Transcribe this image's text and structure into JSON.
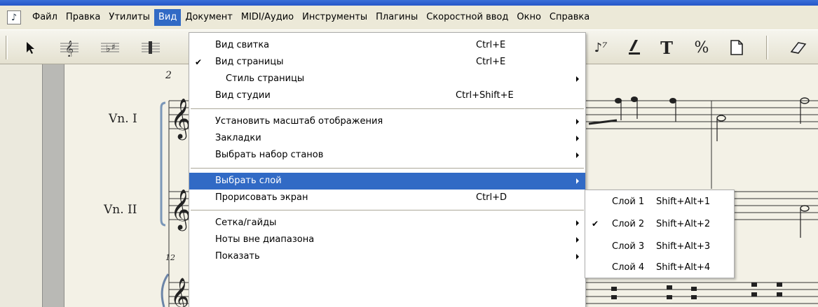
{
  "menubar": {
    "items": [
      {
        "label": "Файл"
      },
      {
        "label": "Правка"
      },
      {
        "label": "Утилиты"
      },
      {
        "label": "Вид",
        "active": true
      },
      {
        "label": "Документ"
      },
      {
        "label": "MIDI/Аудио"
      },
      {
        "label": "Инструменты"
      },
      {
        "label": "Плагины"
      },
      {
        "label": "Скоростной ввод"
      },
      {
        "label": "Окно"
      },
      {
        "label": "Справка"
      }
    ]
  },
  "toolbar": {
    "tools_right": [
      {
        "icon": "text-tool-icon",
        "glyph": "T"
      },
      {
        "icon": "percent-tool-icon",
        "glyph": "%"
      }
    ]
  },
  "score": {
    "instruments": [
      {
        "label": "Vn. I"
      },
      {
        "label": "Vn. II"
      }
    ],
    "measure_numbers": [
      "2",
      "12"
    ]
  },
  "view_menu": {
    "items": [
      {
        "label": "Вид свитка",
        "shortcut": "Ctrl+E"
      },
      {
        "label": "Вид страницы",
        "shortcut": "Ctrl+E",
        "checked": true
      },
      {
        "label": "Стиль страницы",
        "submenu": true
      },
      {
        "label": "Вид студии",
        "shortcut": "Ctrl+Shift+E"
      },
      {
        "label": "Установить масштаб отображения",
        "submenu": true
      },
      {
        "label": "Закладки",
        "submenu": true
      },
      {
        "label": "Выбрать набор станов",
        "submenu": true
      },
      {
        "label": "Выбрать слой",
        "submenu": true,
        "highlighted": true
      },
      {
        "label": "Прорисовать экран",
        "shortcut": "Ctrl+D"
      },
      {
        "label": "Сетка/гайды",
        "submenu": true
      },
      {
        "label": "Ноты вне диапазона",
        "submenu": true
      },
      {
        "label": "Показать",
        "submenu": true
      }
    ]
  },
  "layer_submenu": {
    "items": [
      {
        "label": "Слой 1",
        "shortcut": "Shift+Alt+1"
      },
      {
        "label": "Слой 2",
        "shortcut": "Shift+Alt+2",
        "checked": true
      },
      {
        "label": "Слой 3",
        "shortcut": "Shift+Alt+3"
      },
      {
        "label": "Слой 4",
        "shortcut": "Shift+Alt+4"
      }
    ]
  },
  "colors": {
    "highlight": "#316ac5",
    "menubar_bg": "#ece9d8",
    "score_bg": "#f3f1e6"
  }
}
